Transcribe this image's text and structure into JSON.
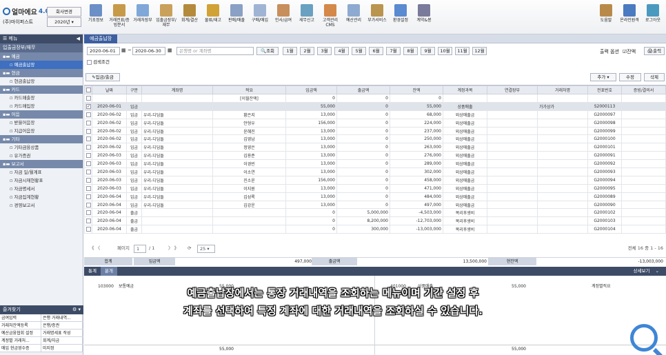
{
  "app": {
    "logo": "얼마에요",
    "version": "4.0",
    "company": "(주)마이퍼스트",
    "change_company": "회사변경",
    "year": "2020년"
  },
  "toolbar": [
    "기초정보",
    "거래전표/증빙문서",
    "거래처장부",
    "입출금장부/재무",
    "회계/결산",
    "물류/재고",
    "판매/매출",
    "구매/매입",
    "인사/급여",
    "세무신고",
    "고객관리CMS",
    "예산관리",
    "부가서비스",
    "환경설정",
    "계약&봉"
  ],
  "toolbar_right": [
    "도움말",
    "온라인원격",
    "로그아웃"
  ],
  "left": {
    "header": "메뉴",
    "section": "입출금장부/재무",
    "tree": [
      {
        "type": "g",
        "label": "예금"
      },
      {
        "type": "c",
        "label": "예금출납장",
        "selected": true
      },
      {
        "type": "g",
        "label": "현금"
      },
      {
        "type": "c",
        "label": "현금출납장"
      },
      {
        "type": "g",
        "label": "카드"
      },
      {
        "type": "c",
        "label": "카드매출장"
      },
      {
        "type": "c",
        "label": "카드매입장"
      },
      {
        "type": "g",
        "label": "어음"
      },
      {
        "type": "c",
        "label": "받을어음장"
      },
      {
        "type": "c",
        "label": "지급어음장"
      },
      {
        "type": "g",
        "label": "기타"
      },
      {
        "type": "c",
        "label": "기타금융상품"
      },
      {
        "type": "c",
        "label": "유가증권"
      },
      {
        "type": "g",
        "label": "보고서"
      },
      {
        "type": "c",
        "label": "자금 일/월계표"
      },
      {
        "type": "c",
        "label": "자금시재현황표"
      },
      {
        "type": "c",
        "label": "자금명세서"
      },
      {
        "type": "c",
        "label": "자금집계현황"
      },
      {
        "type": "c",
        "label": "경영보고서"
      }
    ],
    "favorites_header": "즐겨찾기",
    "favorites": [
      [
        "금여입력",
        "은행 거래내역..."
      ],
      [
        "거래처잔액등록",
        "은행/증권"
      ],
      [
        "예산금융협회 설정",
        "거래명세표 작성"
      ],
      [
        "계정별 거래처...",
        "회계/자금"
      ],
      [
        "매입 현금영수증",
        "미지정"
      ]
    ]
  },
  "main": {
    "tab": "예금출납장",
    "date_from": "2020-06-01",
    "date_to": "2020-06-30",
    "search_placeholder": "은행명 or 계좌명",
    "search_btn": "조회",
    "months": [
      "1월",
      "2월",
      "3월",
      "4월",
      "5월",
      "6월",
      "7월",
      "8월",
      "9월",
      "10월",
      "11월",
      "12월"
    ],
    "print_option": "출력 옵션",
    "balance_check": "잔액",
    "print_btn": "출력",
    "search_condition": "검색조건",
    "deposit_btn": "입금/출금",
    "add_btn": "추가",
    "edit_btn": "수정",
    "delete_btn": "삭제",
    "columns": [
      "",
      "날짜",
      "구분",
      "계좌명",
      "적요",
      "입금액",
      "출금액",
      "잔액",
      "계정과목",
      "연결장부",
      "거래처명",
      "전표번호",
      "증빙/결의서"
    ],
    "rows": [
      [
        "",
        "",
        "",
        "",
        "[이월잔액]",
        "0",
        "0",
        "0",
        "",
        "",
        "",
        "",
        ""
      ],
      [
        "✓",
        "2020-06-01",
        "입금",
        "",
        "",
        "55,000",
        "0",
        "55,000",
        "상품매출",
        "",
        "가가상가",
        "S2000113",
        ""
      ],
      [
        "",
        "2020-06-02",
        "입금",
        "우리-디딤돌",
        "황은지",
        "13,000",
        "0",
        "68,000",
        "외상매출금",
        "",
        "",
        "G2000097",
        ""
      ],
      [
        "",
        "2020-06-02",
        "입금",
        "우리-디딤돌",
        "안형우",
        "156,000",
        "0",
        "224,000",
        "외상매출금",
        "",
        "",
        "G2000098",
        ""
      ],
      [
        "",
        "2020-06-02",
        "입금",
        "우리-디딤돌",
        "윤혜진",
        "13,000",
        "0",
        "237,000",
        "외상매출금",
        "",
        "",
        "G2000099",
        ""
      ],
      [
        "",
        "2020-06-02",
        "입금",
        "우리-디딤돌",
        "김영남",
        "13,000",
        "0",
        "250,000",
        "외상매출금",
        "",
        "",
        "G2000100",
        ""
      ],
      [
        "",
        "2020-06-02",
        "입금",
        "우리-디딤돌",
        "정영은",
        "13,000",
        "0",
        "263,000",
        "외상매출금",
        "",
        "",
        "G2000101",
        ""
      ],
      [
        "",
        "2020-06-03",
        "입금",
        "우리-디딤돌",
        "김용준",
        "13,000",
        "0",
        "276,000",
        "외상매출금",
        "",
        "",
        "G2000091",
        ""
      ],
      [
        "",
        "2020-06-03",
        "입금",
        "우리-디딤돌",
        "이경빈",
        "13,000",
        "0",
        "289,000",
        "외상매출금",
        "",
        "",
        "G2000092",
        ""
      ],
      [
        "",
        "2020-06-03",
        "입금",
        "우리-디딤돌",
        "이소연",
        "13,000",
        "0",
        "302,000",
        "외상매출금",
        "",
        "",
        "G2000093",
        ""
      ],
      [
        "",
        "2020-06-03",
        "입금",
        "우리-디딤돌",
        "진소윤",
        "156,000",
        "0",
        "458,000",
        "외상매출금",
        "",
        "",
        "G2000094",
        ""
      ],
      [
        "",
        "2020-06-03",
        "입금",
        "우리-디딤돌",
        "이지원",
        "13,000",
        "0",
        "471,000",
        "외상매출금",
        "",
        "",
        "G2000095",
        ""
      ],
      [
        "",
        "2020-06-04",
        "입금",
        "우리-디딤돌",
        "김성록",
        "13,000",
        "0",
        "484,000",
        "외상매출금",
        "",
        "",
        "G2000089",
        ""
      ],
      [
        "",
        "2020-06-04",
        "입금",
        "우리-디딤돌",
        "김강운",
        "13,000",
        "0",
        "497,000",
        "외상매출금",
        "",
        "",
        "G2000090",
        ""
      ],
      [
        "",
        "2020-06-04",
        "출금",
        "",
        "",
        "0",
        "5,000,000",
        "-4,503,000",
        "복리후생비",
        "",
        "",
        "G2000102",
        ""
      ],
      [
        "",
        "2020-06-04",
        "출금",
        "",
        "",
        "0",
        "8,200,000",
        "-12,703,000",
        "복리후생비",
        "",
        "",
        "G2000103",
        ""
      ],
      [
        "",
        "2020-06-04",
        "출금",
        "",
        "",
        "0",
        "300,000",
        "-13,003,000",
        "복리후생비",
        "",
        "",
        "G2000104",
        ""
      ]
    ],
    "pager": {
      "label": "페이지",
      "page": "1",
      "total": "/ 1",
      "size": "25",
      "count": "전체 16 중 1 - 16"
    },
    "summary": {
      "label": "합계",
      "in_label": "입금액",
      "in": "497,000",
      "out_label": "출금액",
      "out": "13,500,000",
      "bal_label": "현잔액",
      "bal": "-13,003,000"
    },
    "lower_tabs": [
      "통계",
      "분개"
    ],
    "lower_right": "상세보기",
    "lower_row": {
      "code1": "103000",
      "name1": "보통예금",
      "amt1": "55,000",
      "code2": "401000",
      "name2": "상품매출",
      "amt2": "55,000",
      "label3": "계정별적요"
    },
    "lower_total_1": "55,000",
    "lower_total_2": "55,000"
  },
  "caption": [
    "예금출납장에서는 통장 거래내역을 조회하는 메뉴이며 기간 설정 후",
    "계좌를 선택하여 특정 계좌에 대한 거래내역을 조회하실 수 있습니다."
  ]
}
